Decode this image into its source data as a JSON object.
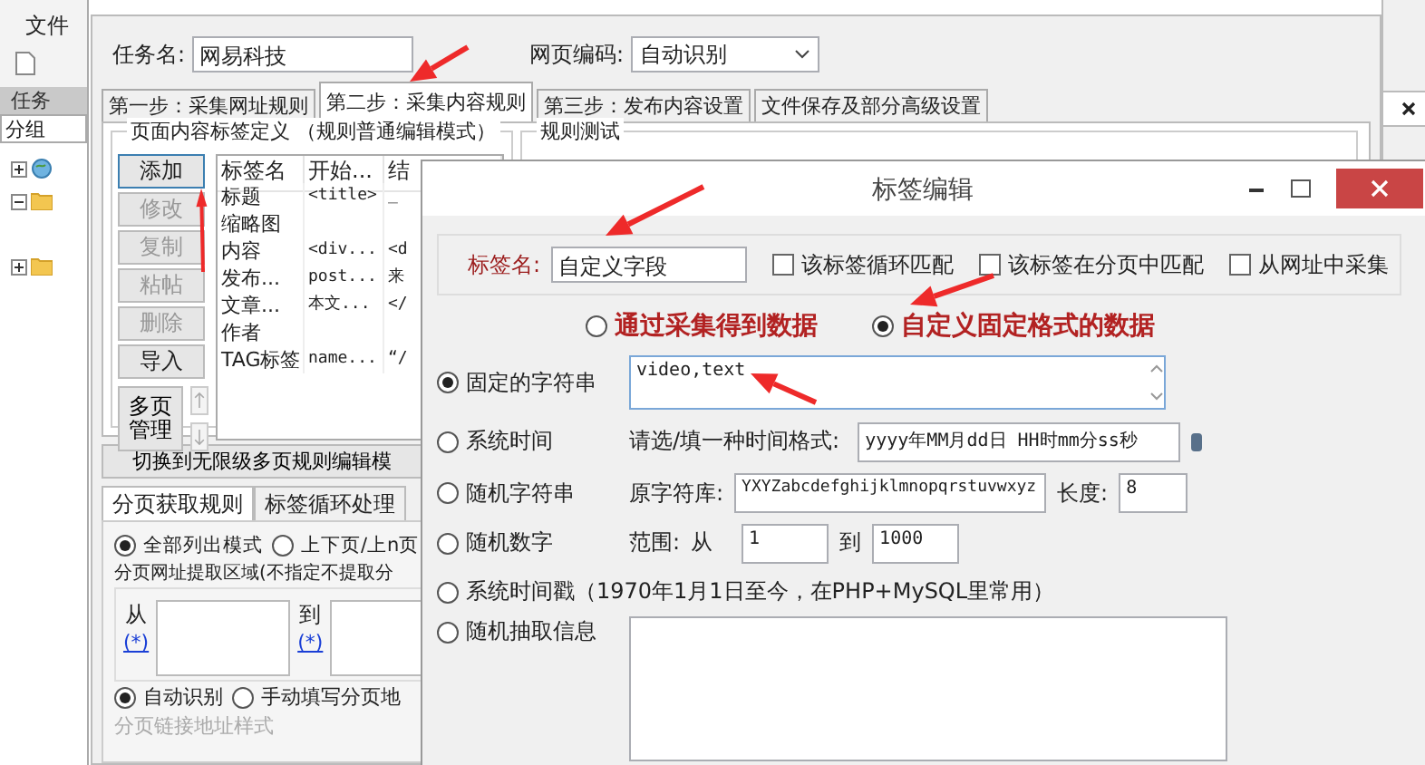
{
  "app": {
    "menu": "文件",
    "panel_header": "任务",
    "group_label": "分组",
    "tree": [
      {
        "kind": "globe",
        "expanded": false
      },
      {
        "kind": "folder",
        "expanded": true
      },
      {
        "kind": "folder",
        "expanded": false
      }
    ]
  },
  "task_window": {
    "task_name_label": "任务名:",
    "task_name": "网易科技",
    "encoding_label": "网页编码:",
    "encoding": "自动识别",
    "tabs": [
      {
        "label": "第一步：采集网址规则",
        "selected": false
      },
      {
        "label": "第二步：采集内容规则",
        "selected": true
      },
      {
        "label": "第三步：发布内容设置",
        "selected": false
      },
      {
        "label": "文件保存及部分高级设置",
        "selected": false
      }
    ],
    "tag_group": {
      "title": "页面内容标签定义 （规则普通编辑模式）",
      "buttons": [
        {
          "label": "添加",
          "disabled": false
        },
        {
          "label": "修改",
          "disabled": true
        },
        {
          "label": "复制",
          "disabled": true
        },
        {
          "label": "粘帖",
          "disabled": true
        },
        {
          "label": "删除",
          "disabled": true
        },
        {
          "label": "导入",
          "disabled": false
        }
      ],
      "multipage_button": "多页管理",
      "table": {
        "columns": [
          "标签名",
          "开始...",
          "结"
        ],
        "rows": [
          [
            "标题",
            "<title>",
            "_"
          ],
          [
            "缩略图",
            "",
            ""
          ],
          [
            "内容",
            "<div...",
            "<d"
          ],
          [
            "发布...",
            "post...",
            "来"
          ],
          [
            "文章...",
            "本文...",
            "</"
          ],
          [
            "作者",
            "",
            ""
          ],
          [
            "TAG标签",
            "name...",
            "“/"
          ]
        ]
      }
    },
    "test_group": {
      "title": "规则测试"
    },
    "switch_button": "切换到无限级多页规则编辑模",
    "subtabs": [
      {
        "label": "分页获取规则",
        "selected": true
      },
      {
        "label": "标签循环处理",
        "selected": false
      }
    ],
    "page_modes": [
      {
        "label": "全部列出模式",
        "selected": true
      },
      {
        "label": "上下页/上n页",
        "selected": false
      }
    ],
    "area_title": "分页网址提取区域(不指定不提取分",
    "from_label": "从",
    "to_label": "到",
    "wildcard_links": [
      "(*)",
      "(*)"
    ],
    "link_modes": [
      {
        "label": "自动识别",
        "selected": true
      },
      {
        "label": "手动填写分页地",
        "selected": false
      }
    ],
    "link_style_label": "分页链接地址样式"
  },
  "dialog": {
    "title": "标签编辑",
    "tag_name_label": "标签名:",
    "tag_name": "自定义字段",
    "options": [
      {
        "label": "该标签循环匹配",
        "checked": false
      },
      {
        "label": "该标签在分页中匹配",
        "checked": false
      },
      {
        "label": "从网址中采集",
        "checked": false
      }
    ],
    "sources": [
      {
        "label": "通过采集得到数据",
        "selected": false
      },
      {
        "label": "自定义固定格式的数据",
        "selected": true
      }
    ],
    "formats": [
      {
        "kind": "text",
        "label": "固定的字符串",
        "selected": true,
        "value": "video,text"
      },
      {
        "kind": "time",
        "label": "系统时间",
        "selected": false,
        "hint": "请选/填一种时间格式:",
        "value": "yyyy年MM月dd日 HH时mm分ss秒"
      },
      {
        "kind": "random_string",
        "label": "随机字符串",
        "selected": false,
        "charset_label": "原字符库:",
        "charset": "YXYZabcdefghijklmnopqrstuvwxyz",
        "length_label": "长度:",
        "length": "8"
      },
      {
        "kind": "range",
        "label": "随机数字",
        "selected": false,
        "range_label": "范围:",
        "from_label": "从",
        "from": "1",
        "to_label": "到",
        "to": "1000"
      },
      {
        "kind": "plain",
        "label": "系统时间戳（1970年1月1日至今，在PHP+MySQL里常用）",
        "selected": false
      },
      {
        "kind": "list",
        "label": "随机抽取信息",
        "selected": false
      }
    ]
  }
}
